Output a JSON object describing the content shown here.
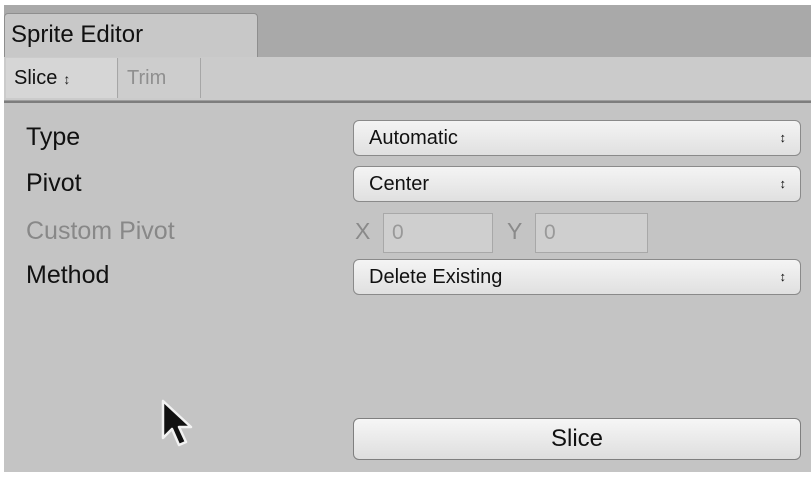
{
  "window": {
    "title": "Sprite Editor"
  },
  "toolbar": {
    "slice_label": "Slice",
    "slice_arrows": "↕",
    "trim_label": "Trim"
  },
  "form": {
    "type_label": "Type",
    "type_value": "Automatic",
    "pivot_label": "Pivot",
    "pivot_value": "Center",
    "custom_pivot_label": "Custom Pivot",
    "custom_pivot_x_label": "X",
    "custom_pivot_x_value": "0",
    "custom_pivot_y_label": "Y",
    "custom_pivot_y_value": "0",
    "method_label": "Method",
    "method_value": "Delete Existing",
    "dropdown_arrows": "↕"
  },
  "actions": {
    "slice_button_label": "Slice"
  },
  "icons": {
    "cursor": "mouse-pointer-icon"
  }
}
